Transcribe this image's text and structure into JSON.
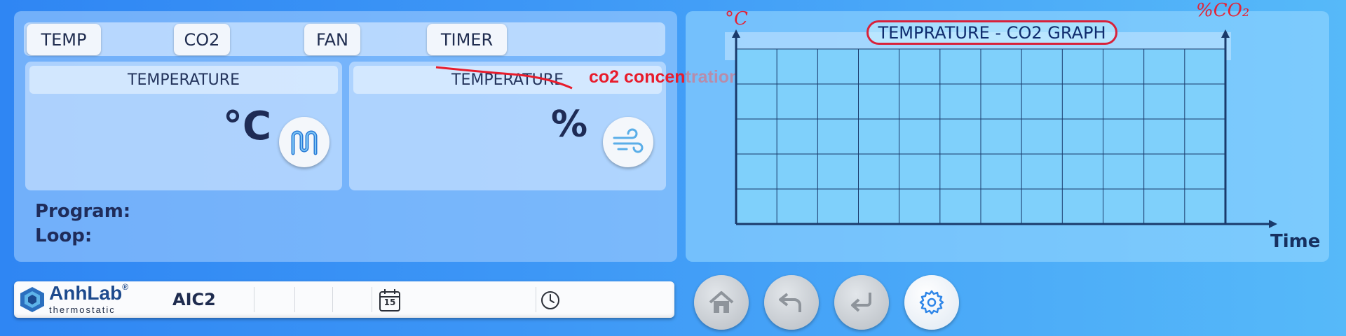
{
  "tabs": [
    {
      "label": "TEMP"
    },
    {
      "label": "CO2"
    },
    {
      "label": "FAN"
    },
    {
      "label": "TIMER"
    }
  ],
  "temperature_card": {
    "header": "TEMPERATURE",
    "unit": "°C",
    "icon": "heater-coil-icon"
  },
  "co2_card": {
    "header": "TEMPERATURE",
    "annotation": "co2 concentration",
    "unit": "%",
    "icon": "wind-icon"
  },
  "program": {
    "label": "Program:",
    "value": ""
  },
  "loop": {
    "label": "Loop:",
    "value": ""
  },
  "graph": {
    "title": "TEMPRATURE - CO2 GRAPH",
    "left_axis_note": "°C",
    "right_axis_note": "%CO₂",
    "x_axis_label": "Time",
    "columns": 12,
    "rows": 5
  },
  "status_bar": {
    "brand_name": "AnhLab",
    "brand_mark": "®",
    "brand_tagline": "thermostatic",
    "device": "AIC2",
    "calendar_icon": "calendar-icon",
    "calendar_day": "15",
    "clock_icon": "clock-icon"
  },
  "nav_buttons": [
    {
      "name": "home",
      "icon": "home-icon"
    },
    {
      "name": "back",
      "icon": "back-arrow-icon"
    },
    {
      "name": "enter",
      "icon": "enter-icon"
    },
    {
      "name": "settings",
      "icon": "gear-icon"
    }
  ],
  "colors": {
    "accent_dark": "#1f2c4f",
    "annotation_red": "#e81c2c",
    "grid_line": "#1a3a6b"
  }
}
